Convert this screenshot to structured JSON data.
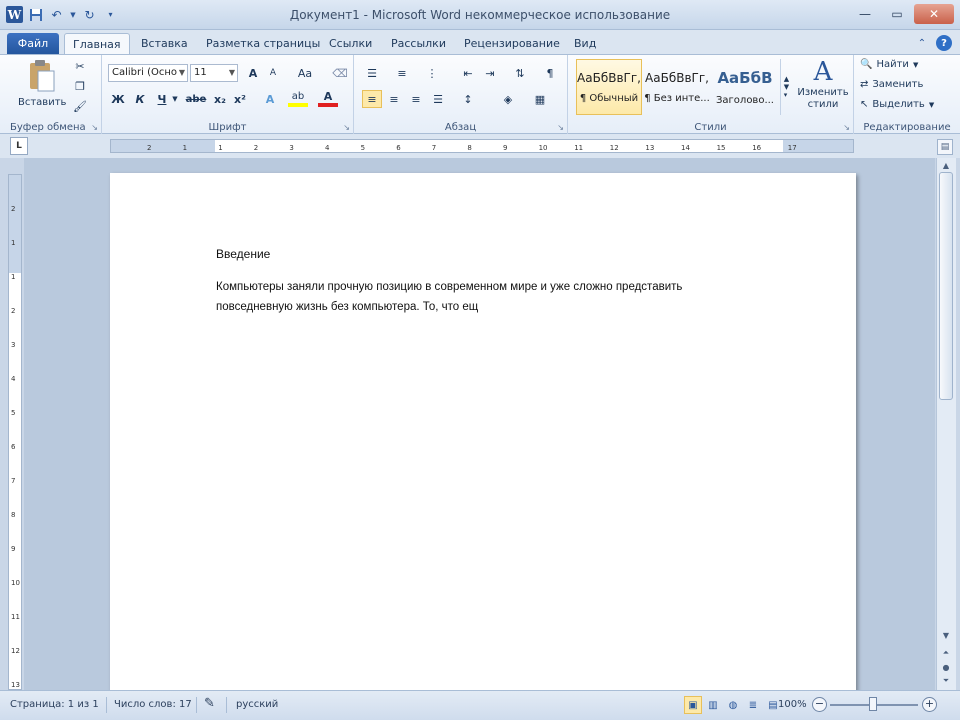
{
  "window": {
    "title": "Документ1  -  Microsoft Word некоммерческое использование"
  },
  "qat": {
    "app_icon": "W"
  },
  "tabs": [
    {
      "label": "Файл"
    },
    {
      "label": "Главная"
    },
    {
      "label": "Вставка"
    },
    {
      "label": "Разметка страницы"
    },
    {
      "label": "Ссылки"
    },
    {
      "label": "Рассылки"
    },
    {
      "label": "Рецензирование"
    },
    {
      "label": "Вид"
    }
  ],
  "ribbon": {
    "clipboard": {
      "label": "Буфер обмена",
      "paste_label": "Вставить"
    },
    "font": {
      "label": "Шрифт",
      "font_name": "Calibri (Осно",
      "font_size": "11",
      "bold": "Ж",
      "italic": "К",
      "underline": "Ч",
      "strike": "abe",
      "subscript": "x₂",
      "superscript": "x²",
      "grow": "A",
      "shrink": "A",
      "case": "Aa",
      "effects": "A",
      "highlight": "ab",
      "font_color": "A"
    },
    "paragraph": {
      "label": "Абзац"
    },
    "styles": {
      "label": "Стили",
      "items": [
        {
          "preview": "АаБбВвГг,",
          "name": "¶ Обычный"
        },
        {
          "preview": "АаБбВвГг,",
          "name": "¶ Без инте..."
        },
        {
          "preview": "АаБбВ",
          "name": "Заголово..."
        }
      ],
      "change_styles": "Изменить стили"
    },
    "editing": {
      "label": "Редактирование",
      "find": "Найти",
      "replace": "Заменить",
      "select": "Выделить"
    }
  },
  "ruler": {
    "tab_selector": "L",
    "h_numbers": [
      "2",
      "1",
      "1",
      "2",
      "3",
      "4",
      "5",
      "6",
      "7",
      "8",
      "9",
      "10",
      "11",
      "12",
      "13",
      "14",
      "15",
      "16",
      "17"
    ],
    "v_numbers": [
      "2",
      "1",
      "1",
      "2",
      "3",
      "4",
      "5",
      "6",
      "7",
      "8",
      "9",
      "10",
      "11",
      "12",
      "13"
    ]
  },
  "document": {
    "heading": "Введение",
    "body": "Компьютеры заняли прочную позицию в современном мире и уже сложно представить повседневную жизнь без компьютера. То, что ещ"
  },
  "status": {
    "page": "Страница: 1 из 1",
    "words": "Число слов: 17",
    "language": "русский",
    "zoom": "100%",
    "zoom_minus": "−",
    "zoom_plus": "+"
  },
  "colors": {
    "accent": "#2b579a",
    "ribbon_bg": "#e6eef8",
    "page": "#ffffff",
    "workspace": "#b9c9dd"
  }
}
